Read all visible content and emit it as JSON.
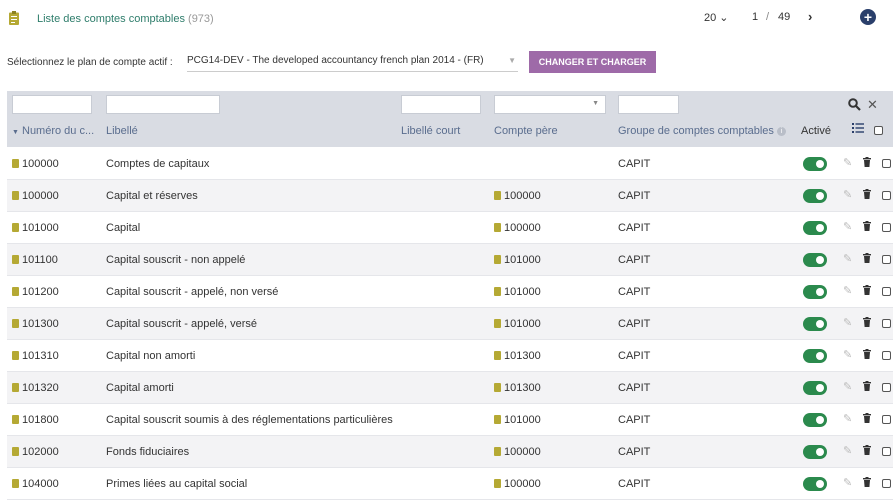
{
  "header": {
    "title": "Liste des comptes comptables",
    "count": "(973)",
    "page_size": "20 ⌄",
    "page_current": "1",
    "page_sep": "/",
    "page_total": "49",
    "next_label": "›",
    "add_label": "+"
  },
  "plan": {
    "label": "Sélectionnez le plan de compte actif :",
    "selected": "PCG14-DEV - The developed accountancy french plan 2014 - (FR)",
    "button": "CHANGER ET CHARGER"
  },
  "columns": {
    "numero": "Numéro du c...",
    "libelle": "Libellé",
    "libelle_court": "Libellé court",
    "compte_pere": "Compte père",
    "groupe": "Groupe de comptes comptables",
    "active": "Activé"
  },
  "rows": [
    {
      "numero": "100000",
      "libelle": "Comptes de capitaux",
      "pere": "",
      "groupe": "CAPIT"
    },
    {
      "numero": "100000",
      "libelle": "Capital et réserves",
      "pere": "100000",
      "groupe": "CAPIT"
    },
    {
      "numero": "101000",
      "libelle": "Capital",
      "pere": "100000",
      "groupe": "CAPIT"
    },
    {
      "numero": "101100",
      "libelle": "Capital souscrit - non appelé",
      "pere": "101000",
      "groupe": "CAPIT"
    },
    {
      "numero": "101200",
      "libelle": "Capital souscrit - appelé, non versé",
      "pere": "101000",
      "groupe": "CAPIT"
    },
    {
      "numero": "101300",
      "libelle": "Capital souscrit - appelé, versé",
      "pere": "101000",
      "groupe": "CAPIT"
    },
    {
      "numero": "101310",
      "libelle": "Capital non amorti",
      "pere": "101300",
      "groupe": "CAPIT"
    },
    {
      "numero": "101320",
      "libelle": "Capital amorti",
      "pere": "101300",
      "groupe": "CAPIT"
    },
    {
      "numero": "101800",
      "libelle": "Capital souscrit soumis à des réglementations particulières",
      "pere": "101000",
      "groupe": "CAPIT"
    },
    {
      "numero": "102000",
      "libelle": "Fonds fiduciaires",
      "pere": "100000",
      "groupe": "CAPIT"
    },
    {
      "numero": "104000",
      "libelle": "Primes liées au capital social",
      "pere": "100000",
      "groupe": "CAPIT"
    }
  ],
  "colors": {
    "accent": "#9e6aa8",
    "toggle": "#2b8a4d",
    "link": "#2a3f6b",
    "filter_bg": "#d9dce3"
  },
  "icons": {
    "clipboard": "clipboard-icon",
    "search": "search-icon",
    "close": "close-icon",
    "add": "plus-circle-icon",
    "edit": "pencil-icon",
    "delete": "trash-icon",
    "list": "list-icon"
  }
}
